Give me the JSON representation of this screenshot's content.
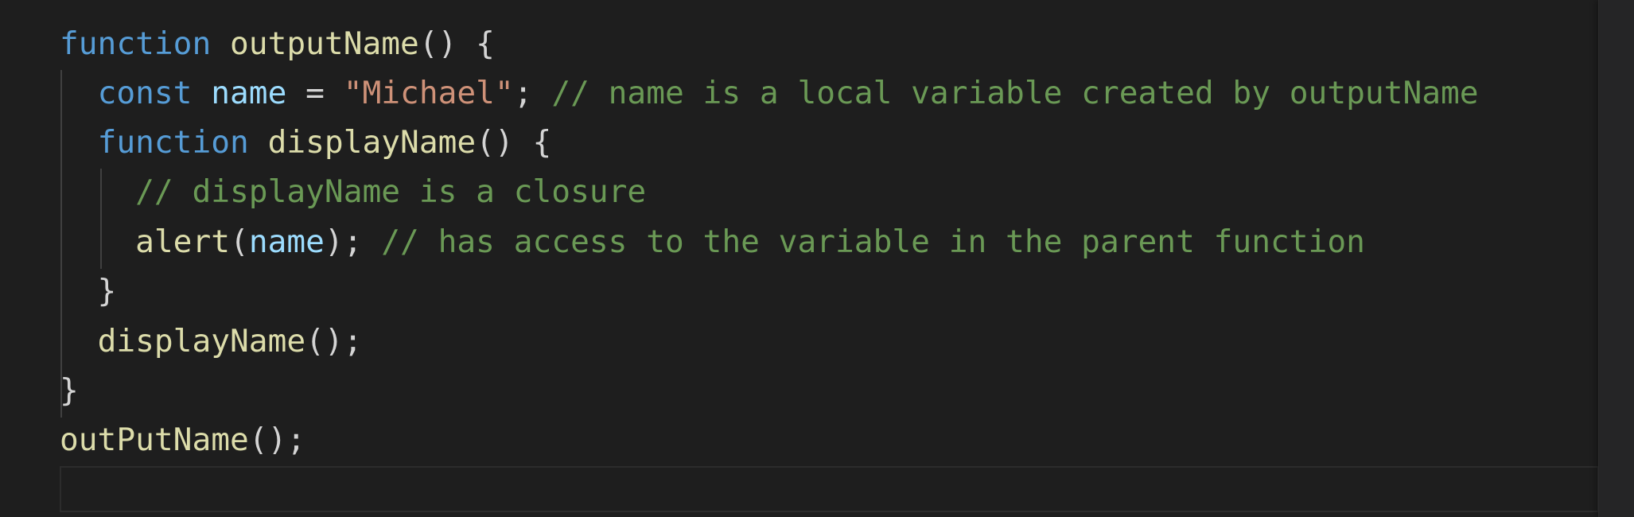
{
  "editor": {
    "lines": [
      [
        {
          "t": "function",
          "c": "kw"
        },
        {
          "t": " ",
          "c": "pn"
        },
        {
          "t": "outputName",
          "c": "fn"
        },
        {
          "t": "() {",
          "c": "pn"
        }
      ],
      [
        {
          "t": "  ",
          "c": "pn"
        },
        {
          "t": "const",
          "c": "kw"
        },
        {
          "t": " ",
          "c": "pn"
        },
        {
          "t": "name",
          "c": "var"
        },
        {
          "t": " = ",
          "c": "pn"
        },
        {
          "t": "\"Michael\"",
          "c": "str"
        },
        {
          "t": "; ",
          "c": "pn"
        },
        {
          "t": "// name is a local variable created by outputName",
          "c": "cm"
        }
      ],
      [
        {
          "t": "  ",
          "c": "pn"
        },
        {
          "t": "function",
          "c": "kw"
        },
        {
          "t": " ",
          "c": "pn"
        },
        {
          "t": "displayName",
          "c": "fn"
        },
        {
          "t": "() {",
          "c": "pn"
        }
      ],
      [
        {
          "t": "    ",
          "c": "pn"
        },
        {
          "t": "// displayName is a closure",
          "c": "cm"
        }
      ],
      [
        {
          "t": "    ",
          "c": "pn"
        },
        {
          "t": "alert",
          "c": "fn"
        },
        {
          "t": "(",
          "c": "pn"
        },
        {
          "t": "name",
          "c": "var"
        },
        {
          "t": "); ",
          "c": "pn"
        },
        {
          "t": "// has access to the variable in the parent function",
          "c": "cm"
        }
      ],
      [
        {
          "t": "  }",
          "c": "pn"
        }
      ],
      [
        {
          "t": "  ",
          "c": "pn"
        },
        {
          "t": "displayName",
          "c": "fn"
        },
        {
          "t": "();",
          "c": "pn"
        }
      ],
      [
        {
          "t": "}",
          "c": "pn"
        }
      ],
      [
        {
          "t": "outPutName",
          "c": "fn"
        },
        {
          "t": "();",
          "c": "pn"
        }
      ]
    ]
  },
  "colors": {
    "background": "#1e1e1e",
    "keyword": "#569cd6",
    "function": "#dcdcaa",
    "variable": "#9cdcfe",
    "string": "#ce9178",
    "comment": "#6a9955",
    "punctuation": "#d4d4d4"
  }
}
